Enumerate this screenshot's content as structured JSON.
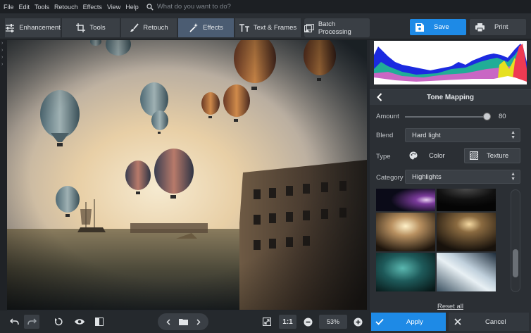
{
  "menu": {
    "items": [
      "File",
      "Edit",
      "Tools",
      "Retouch",
      "Effects",
      "View",
      "Help"
    ],
    "search_placeholder": "What do you want to do?"
  },
  "tabs": [
    {
      "label": "Enhancement",
      "icon": "sliders-icon"
    },
    {
      "label": "Tools",
      "icon": "crop-icon"
    },
    {
      "label": "Retouch",
      "icon": "brush-icon"
    },
    {
      "label": "Effects",
      "icon": "magic-wand-icon",
      "active": true
    },
    {
      "label": "Text & Frames",
      "icon": "text-icon"
    },
    {
      "label": "Batch Processing",
      "icon": "images-icon"
    }
  ],
  "actions": {
    "save": "Save",
    "print": "Print"
  },
  "panel": {
    "title": "Tone Mapping",
    "amount_label": "Amount",
    "amount_value": "80",
    "blend_label": "Blend",
    "blend_value": "Hard light",
    "type_label": "Type",
    "type_color": "Color",
    "type_texture": "Texture",
    "category_label": "Category",
    "category_value": "Highlights",
    "reset": "Reset all",
    "apply": "Apply",
    "cancel": "Cancel"
  },
  "bottom": {
    "ratio": "1:1",
    "zoom": "53%"
  },
  "colors": {
    "accent": "#1e8ae6",
    "active_tab": "#4b5c72"
  }
}
